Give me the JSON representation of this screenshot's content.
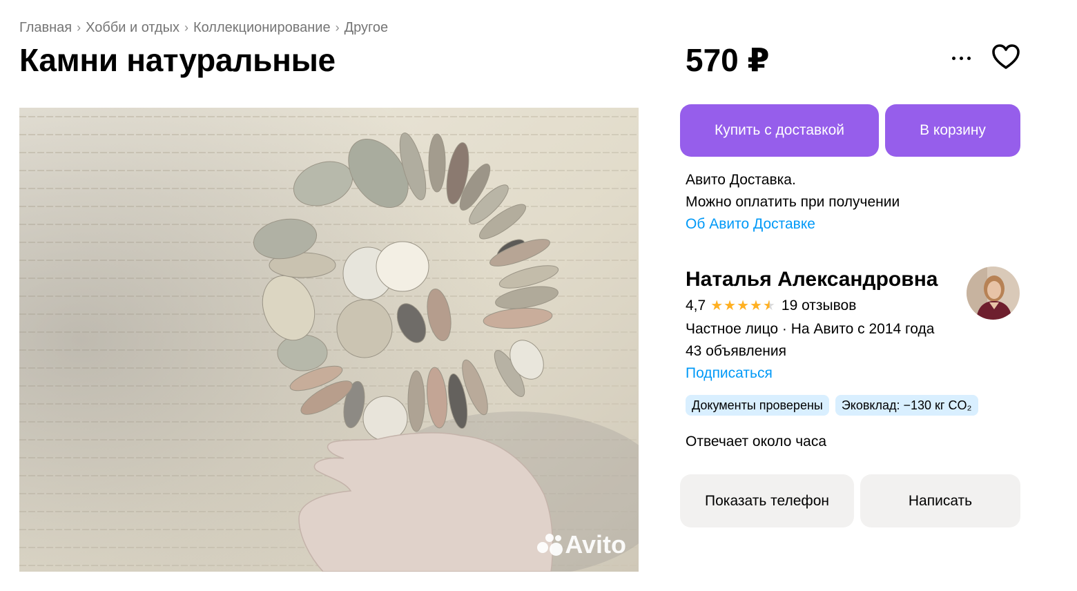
{
  "breadcrumbs": [
    "Главная",
    "Хобби и отдых",
    "Коллекционирование",
    "Другое"
  ],
  "listing": {
    "title": "Камни натуральные",
    "price": "570 ₽",
    "photo_watermark": "Avito"
  },
  "actions": {
    "buy_label": "Купить с доставкой",
    "cart_label": "В корзину",
    "more_icon": "more-horizontal-icon",
    "favorite_icon": "heart-icon"
  },
  "delivery": {
    "line1": "Авито Доставка.",
    "line2": "Можно оплатить при получении",
    "link": "Об Авито Доставке"
  },
  "seller": {
    "name": "Наталья Александровна",
    "rating": "4,7",
    "rating_value": 4.7,
    "reviews": "19 отзывов",
    "type_since": "Частное лицо · На Авито с 2014 года",
    "ads": "43 объявления",
    "subscribe": "Подписаться",
    "badges": [
      "Документы проверены",
      "Эковклад: −130 кг CO₂"
    ],
    "responds": "Отвечает около часа"
  },
  "contact": {
    "phone_label": "Показать телефон",
    "write_label": "Написать"
  },
  "colors": {
    "primary": "#965eeb",
    "link": "#0099f7",
    "badge_bg": "#d9efff",
    "star": "#ffb021",
    "secondary_btn": "#f2f1f0"
  }
}
